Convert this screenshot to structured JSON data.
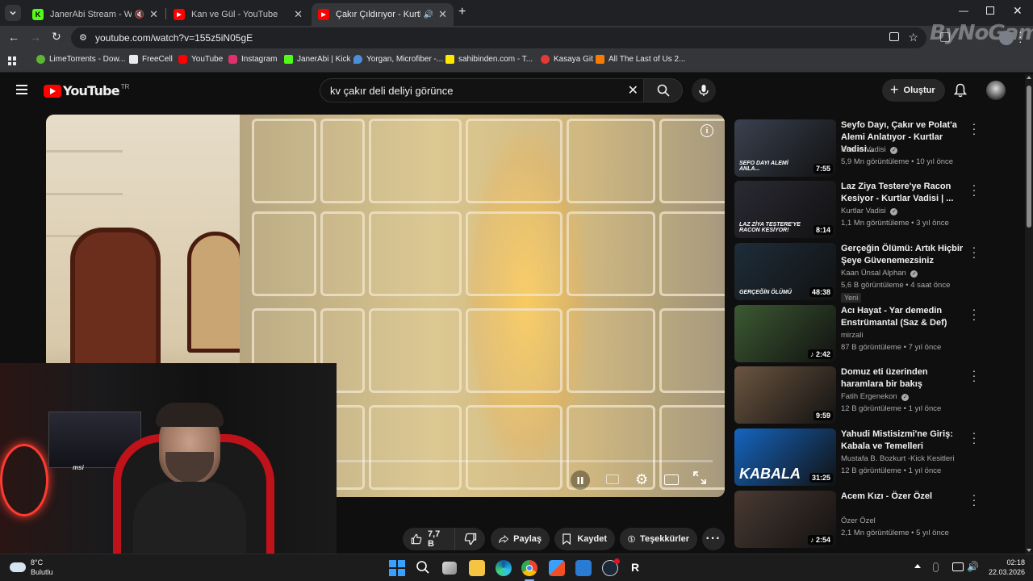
{
  "tabs": [
    {
      "title": "JanerAbi Stream - Watch Li",
      "fav": "K",
      "favcolor": "#53fc18"
    },
    {
      "title": "Kan ve Gül - YouTube",
      "fav": "▶",
      "favcolor": "#ff0000"
    },
    {
      "title": "Çakır Çıldırıyor - Kurtlar Vad",
      "fav": "▶",
      "favcolor": "#ff0000"
    }
  ],
  "address": {
    "url": "youtube.com/watch?v=155z5iN05gE"
  },
  "watermark": "ByNoGame",
  "bookmarks": [
    {
      "label": "LimeTorrents - Dow...",
      "color": "#5fb336"
    },
    {
      "label": "FreeCell",
      "color": "#e8eaed"
    },
    {
      "label": "YouTube",
      "color": "#ff0000"
    },
    {
      "label": "Instagram",
      "color": "#e1306c"
    },
    {
      "label": "JanerAbi | Kick",
      "color": "#53fc18"
    },
    {
      "label": "Yorgan, Microfiber -...",
      "color": "#4a90d9"
    },
    {
      "label": "sahibinden.com - T...",
      "color": "#ffe800"
    },
    {
      "label": "Kasaya Git",
      "color": "#e53935"
    },
    {
      "label": "All The Last of Us 2...",
      "color": "#f57c00"
    }
  ],
  "yt": {
    "logo": "YouTube",
    "region": "TR",
    "search_value": "kv çakır deli deliyi görünce",
    "create_label": "Oluştur"
  },
  "actions": {
    "like_count": "7,7 B",
    "share": "Paylaş",
    "save": "Kaydet",
    "thanks": "Teşekkürler"
  },
  "recommendations": [
    {
      "title": "Seyfo Dayı, Çakır ve Polat'a Alemi Anlatıyor - Kurtlar Vadisi...",
      "channel": "Kurtlar Vadisi",
      "verified": true,
      "meta": "5,9 Mn görüntüleme • 10 yıl önce",
      "duration": "7:55",
      "badge": "",
      "thumb_text": "SEFO DAYI ALEMİ ANLA...",
      "thumb_color": "#3a4150"
    },
    {
      "title": "Laz Ziya Testere'ye Racon Kesiyor - Kurtlar Vadisi | ...",
      "channel": "Kurtlar Vadisi",
      "verified": true,
      "meta": "1,1 Mn görüntüleme • 3 yıl önce",
      "duration": "8:14",
      "badge": "",
      "thumb_text": "LAZ ZİYA TESTERE'YE RACON KESİYOR!",
      "thumb_color": "#2a2a34"
    },
    {
      "title": "Gerçeğin Ölümü: Artık Hiçbir Şeye Güvenemezsiniz",
      "channel": "Kaan Ünsal Alphan",
      "verified": true,
      "meta": "5,6 B görüntüleme • 4 saat önce",
      "duration": "48:38",
      "badge": "Yeni",
      "thumb_text": "GERÇEĞİN ÖLÜMÜ",
      "thumb_color": "#1e2d3a"
    },
    {
      "title": "Acı Hayat  -  Yar demedin Enstrümantal  (Saz & Def)",
      "channel": "mirzali",
      "verified": false,
      "meta": "87 B görüntüleme • 7 yıl önce",
      "duration": "♪ 2:42",
      "badge": "",
      "thumb_text": "",
      "thumb_color": "#3c5a32"
    },
    {
      "title": "Domuz eti üzerinden haramlara bir bakış",
      "channel": "Fatih Ergenekon",
      "verified": true,
      "meta": "12 B görüntüleme • 1 yıl önce",
      "duration": "9:59",
      "badge": "",
      "thumb_text": "",
      "thumb_color": "#6b5540"
    },
    {
      "title": "Yahudi Mistisizmi'ne Giriş: Kabala ve Temelleri",
      "channel": "Mustafa B. Bozkurt -Kick Kesitleri",
      "verified": false,
      "meta": "12 B görüntüleme • 1 yıl önce",
      "duration": "31:25",
      "badge": "",
      "thumb_text": "KABALA",
      "thumb_color": "#1565c0"
    },
    {
      "title": "Acem Kızı - Özer Özel",
      "channel": "Özer Özel",
      "verified": false,
      "meta": "2,1 Mn görüntüleme • 5 yıl önce",
      "duration": "♪ 2:54",
      "badge": "",
      "thumb_text": "",
      "thumb_color": "#4a3a32"
    }
  ],
  "taskbar": {
    "weather_temp": "8°C",
    "weather_desc": "Bulutlu",
    "time": "02:18",
    "date": "22.03.2026"
  }
}
